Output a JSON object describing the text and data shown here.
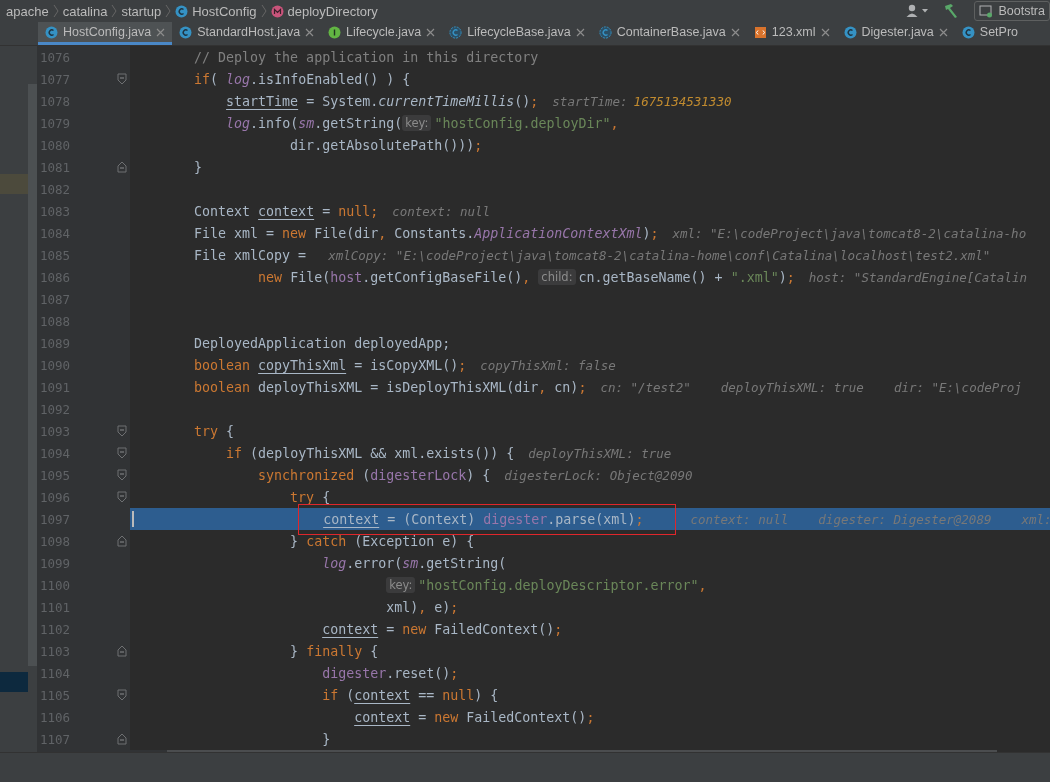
{
  "breadcrumbs": [
    {
      "label": "apache"
    },
    {
      "label": "catalina"
    },
    {
      "label": "startup"
    },
    {
      "label": "HostConfig",
      "kind": "class"
    },
    {
      "label": "deployDirectory",
      "kind": "method"
    }
  ],
  "toolbar": {
    "run_config": "Bootstra"
  },
  "tabs": [
    {
      "label": "HostConfig.java",
      "kind": "class",
      "selected": true,
      "close": true
    },
    {
      "label": "StandardHost.java",
      "kind": "class",
      "selected": false,
      "close": true
    },
    {
      "label": "Lifecycle.java",
      "kind": "interface",
      "selected": false,
      "close": true
    },
    {
      "label": "LifecycleBase.java",
      "kind": "abstract",
      "selected": false,
      "close": true
    },
    {
      "label": "ContainerBase.java",
      "kind": "abstract",
      "selected": false,
      "close": true
    },
    {
      "label": "123.xml",
      "kind": "xml",
      "selected": false,
      "close": true
    },
    {
      "label": "Digester.java",
      "kind": "class",
      "selected": false,
      "close": true
    },
    {
      "label": "SetPro",
      "kind": "class",
      "selected": false,
      "close": false
    }
  ],
  "lines": [
    {
      "number": "1076",
      "selected": false,
      "tokens": [
        {
          "kind": "comment",
          "text": "        // Deploy the application in this directory"
        }
      ]
    },
    {
      "number": "1077",
      "selected": false,
      "kind": "fold-start",
      "tokens": [
        {
          "kind": "keyword",
          "text": "        if"
        },
        {
          "kind": "plain",
          "text": "( "
        },
        {
          "kind": "field",
          "text": "log"
        },
        {
          "kind": "plain",
          "text": ".isInfoEnabled() ) {"
        }
      ]
    },
    {
      "number": "1078",
      "selected": false,
      "tokens": [
        {
          "kind": "var",
          "text": "            startTime"
        },
        {
          "kind": "plain",
          "text": " = System."
        },
        {
          "kind": "italic",
          "text": "currentTimeMillis"
        },
        {
          "kind": "plain",
          "text": "()"
        },
        {
          "kind": "keyword",
          "text": ";"
        },
        {
          "kind": "hint",
          "text": "startTime:"
        },
        {
          "kind": "hint-value",
          "text": "1675134531330"
        }
      ]
    },
    {
      "number": "1079",
      "selected": false,
      "tokens": [
        {
          "kind": "field",
          "text": "            log"
        },
        {
          "kind": "plain",
          "text": ".info("
        },
        {
          "kind": "field",
          "text": "sm"
        },
        {
          "kind": "plain",
          "text": ".getString("
        },
        {
          "kind": "param",
          "text": "key:"
        },
        {
          "kind": "string",
          "text": "\"hostConfig.deployDir\""
        },
        {
          "kind": "keyword",
          "text": ","
        }
      ]
    },
    {
      "number": "1080",
      "selected": false,
      "tokens": [
        {
          "kind": "plain",
          "text": "                    dir.getAbsolutePath()))"
        },
        {
          "kind": "keyword",
          "text": ";"
        }
      ]
    },
    {
      "number": "1081",
      "selected": false,
      "kind": "fold-end",
      "tokens": [
        {
          "kind": "plain",
          "text": "        }"
        }
      ]
    },
    {
      "number": "1082",
      "selected": false
    },
    {
      "number": "1083",
      "selected": false,
      "tokens": [
        {
          "kind": "plain",
          "text": "        Context "
        },
        {
          "kind": "var",
          "text": "context"
        },
        {
          "kind": "plain",
          "text": " = "
        },
        {
          "kind": "keyword",
          "text": "null;"
        },
        {
          "kind": "hint",
          "text": "context: null"
        }
      ]
    },
    {
      "number": "1084",
      "selected": false,
      "tokens": [
        {
          "kind": "plain",
          "text": "        File xml = "
        },
        {
          "kind": "keyword",
          "text": "new"
        },
        {
          "kind": "plain",
          "text": " File(dir"
        },
        {
          "kind": "keyword",
          "text": ","
        },
        {
          "kind": "plain",
          "text": " Constants."
        },
        {
          "kind": "field",
          "text": "ApplicationContextXml"
        },
        {
          "kind": "plain",
          "text": ")"
        },
        {
          "kind": "keyword",
          "text": ";"
        },
        {
          "kind": "hint",
          "text": "xml: \"E:\\codeProject\\java\\tomcat8-2\\catalina-ho"
        }
      ]
    },
    {
      "number": "1085",
      "selected": false,
      "tokens": [
        {
          "kind": "plain",
          "text": "        File xmlCopy = "
        },
        {
          "kind": "hint",
          "text": "xmlCopy: \"E:\\codeProject\\java\\tomcat8-2\\catalina-home\\conf\\Catalina\\localhost\\test2.xml\""
        }
      ]
    },
    {
      "number": "1086",
      "selected": false,
      "tokens": [
        {
          "kind": "keyword",
          "text": "                new"
        },
        {
          "kind": "plain",
          "text": " File("
        },
        {
          "kind": "member",
          "text": "host"
        },
        {
          "kind": "plain",
          "text": ".getConfigBaseFile()"
        },
        {
          "kind": "keyword",
          "text": ", "
        },
        {
          "kind": "param",
          "text": "child:"
        },
        {
          "kind": "plain",
          "text": "cn.getBaseName() + "
        },
        {
          "kind": "string",
          "text": "\".xml\""
        },
        {
          "kind": "plain",
          "text": ")"
        },
        {
          "kind": "keyword",
          "text": ";"
        },
        {
          "kind": "hint",
          "text": "host: \"StandardEngine[Catalin"
        }
      ]
    },
    {
      "number": "1087",
      "selected": false
    },
    {
      "number": "1088",
      "selected": false
    },
    {
      "number": "1089",
      "selected": false,
      "tokens": [
        {
          "kind": "plain",
          "text": "        DeployedApplication deployedApp;"
        }
      ]
    },
    {
      "number": "1090",
      "selected": false,
      "tokens": [
        {
          "kind": "keyword",
          "text": "        boolean "
        },
        {
          "kind": "var",
          "text": "copyThisXml"
        },
        {
          "kind": "plain",
          "text": " = isCopyXML()"
        },
        {
          "kind": "keyword",
          "text": ";"
        },
        {
          "kind": "hint",
          "text": "copyThisXml: false"
        }
      ]
    },
    {
      "number": "1091",
      "selected": false,
      "tokens": [
        {
          "kind": "keyword",
          "text": "        boolean"
        },
        {
          "kind": "plain",
          "text": " deployThisXML = isDeployThisXML(dir"
        },
        {
          "kind": "keyword",
          "text": ","
        },
        {
          "kind": "plain",
          "text": " cn)"
        },
        {
          "kind": "keyword",
          "text": ";"
        },
        {
          "kind": "hint",
          "text": "cn: \"/test2\"    deployThisXML: true    dir: \"E:\\codeProj"
        }
      ]
    },
    {
      "number": "1092",
      "selected": false
    },
    {
      "number": "1093",
      "selected": false,
      "kind": "fold-start",
      "tokens": [
        {
          "kind": "keyword",
          "text": "        try"
        },
        {
          "kind": "plain",
          "text": " {"
        }
      ]
    },
    {
      "number": "1094",
      "selected": false,
      "kind": "fold-start",
      "tokens": [
        {
          "kind": "keyword",
          "text": "            if"
        },
        {
          "kind": "plain",
          "text": " (deployThisXML && xml.exists()) {"
        },
        {
          "kind": "hint",
          "text": "deployThisXML: true"
        }
      ]
    },
    {
      "number": "1095",
      "selected": false,
      "kind": "fold-start",
      "tokens": [
        {
          "kind": "keyword",
          "text": "                synchronized"
        },
        {
          "kind": "plain",
          "text": " ("
        },
        {
          "kind": "member",
          "text": "digesterLock"
        },
        {
          "kind": "plain",
          "text": ") {"
        },
        {
          "kind": "hint",
          "text": "digesterLock: Object@2090"
        }
      ]
    },
    {
      "number": "1096",
      "selected": false,
      "kind": "fold-start",
      "tokens": [
        {
          "kind": "keyword",
          "text": "                    try"
        },
        {
          "kind": "plain",
          "text": " {"
        }
      ]
    },
    {
      "number": "1097",
      "selected": true,
      "tokens": [
        {
          "kind": "boxed",
          "children": [
            {
              "kind": "var",
              "text": "                        context"
            },
            {
              "kind": "plain",
              "text": " = (Context) "
            },
            {
              "kind": "member",
              "text": "digester"
            },
            {
              "kind": "plain",
              "text": ".parse(xml)"
            },
            {
              "kind": "keyword",
              "text": ";"
            }
          ]
        },
        {
          "kind": "hint",
          "text": "context: null    digester: Digester@2089    xml:"
        }
      ]
    },
    {
      "number": "1098",
      "selected": false,
      "kind": "fold-end",
      "tokens": [
        {
          "kind": "plain",
          "text": "                    } "
        },
        {
          "kind": "keyword",
          "text": "catch"
        },
        {
          "kind": "plain",
          "text": " (Exception e) {"
        }
      ]
    },
    {
      "number": "1099",
      "selected": false,
      "tokens": [
        {
          "kind": "field",
          "text": "                        log"
        },
        {
          "kind": "plain",
          "text": ".error("
        },
        {
          "kind": "field",
          "text": "sm"
        },
        {
          "kind": "plain",
          "text": ".getString("
        }
      ]
    },
    {
      "number": "1100",
      "selected": false,
      "tokens": [
        {
          "kind": "param",
          "text": "                                key:"
        },
        {
          "kind": "string",
          "text": "\"hostConfig.deployDescriptor.error\""
        },
        {
          "kind": "keyword",
          "text": ","
        }
      ]
    },
    {
      "number": "1101",
      "selected": false,
      "tokens": [
        {
          "kind": "plain",
          "text": "                                xml)"
        },
        {
          "kind": "keyword",
          "text": ","
        },
        {
          "kind": "plain",
          "text": " e)"
        },
        {
          "kind": "keyword",
          "text": ";"
        }
      ]
    },
    {
      "number": "1102",
      "selected": false,
      "tokens": [
        {
          "kind": "var",
          "text": "                        context"
        },
        {
          "kind": "plain",
          "text": " = "
        },
        {
          "kind": "keyword",
          "text": "new"
        },
        {
          "kind": "plain",
          "text": " FailedContext()"
        },
        {
          "kind": "keyword",
          "text": ";"
        }
      ]
    },
    {
      "number": "1103",
      "selected": false,
      "kind": "fold-end",
      "tokens": [
        {
          "kind": "plain",
          "text": "                    } "
        },
        {
          "kind": "keyword",
          "text": "finally"
        },
        {
          "kind": "plain",
          "text": " {"
        }
      ]
    },
    {
      "number": "1104",
      "selected": false,
      "tokens": [
        {
          "kind": "member",
          "text": "                        digester"
        },
        {
          "kind": "plain",
          "text": ".reset()"
        },
        {
          "kind": "keyword",
          "text": ";"
        }
      ]
    },
    {
      "number": "1105",
      "selected": false,
      "kind": "fold-start",
      "tokens": [
        {
          "kind": "keyword",
          "text": "                        if"
        },
        {
          "kind": "plain",
          "text": " ("
        },
        {
          "kind": "var",
          "text": "context"
        },
        {
          "kind": "plain",
          "text": " == "
        },
        {
          "kind": "keyword",
          "text": "null"
        },
        {
          "kind": "plain",
          "text": ") {"
        }
      ]
    },
    {
      "number": "1106",
      "selected": false,
      "tokens": [
        {
          "kind": "var",
          "text": "                            context"
        },
        {
          "kind": "plain",
          "text": " = "
        },
        {
          "kind": "keyword",
          "text": "new"
        },
        {
          "kind": "plain",
          "text": " FailedContext()"
        },
        {
          "kind": "keyword",
          "text": ";"
        }
      ]
    },
    {
      "number": "1107",
      "selected": false,
      "kind": "fold-end",
      "tokens": [
        {
          "kind": "plain",
          "text": "                        }"
        }
      ]
    }
  ]
}
